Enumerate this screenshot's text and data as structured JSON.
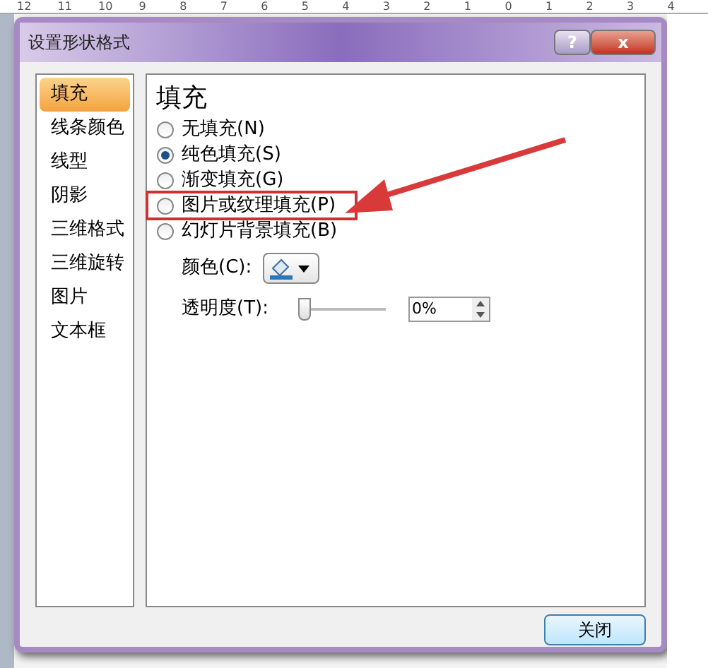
{
  "ruler": {
    "ticks": [
      "12",
      "11",
      "10",
      "9",
      "8",
      "7",
      "6",
      "5",
      "4",
      "3",
      "2",
      "1",
      "0",
      "1",
      "2",
      "3",
      "4"
    ]
  },
  "dialog": {
    "title": "设置形状格式",
    "help": "?",
    "close": "x"
  },
  "sidebar": {
    "items": [
      {
        "label": "填充",
        "selected": true
      },
      {
        "label": "线条颜色",
        "selected": false
      },
      {
        "label": "线型",
        "selected": false
      },
      {
        "label": "阴影",
        "selected": false
      },
      {
        "label": "三维格式",
        "selected": false
      },
      {
        "label": "三维旋转",
        "selected": false
      },
      {
        "label": "图片",
        "selected": false
      },
      {
        "label": "文本框",
        "selected": false
      }
    ]
  },
  "panel": {
    "heading": "填充",
    "options": [
      {
        "label": "无填充(N)",
        "selected": false,
        "highlighted": false
      },
      {
        "label": "纯色填充(S)",
        "selected": true,
        "highlighted": false
      },
      {
        "label": "渐变填充(G)",
        "selected": false,
        "highlighted": false
      },
      {
        "label": "图片或纹理填充(P)",
        "selected": false,
        "highlighted": true
      },
      {
        "label": "幻灯片背景填充(B)",
        "selected": false,
        "highlighted": false
      }
    ],
    "color": {
      "label": "颜色(C):"
    },
    "transparency": {
      "label": "透明度(T):",
      "level": 0,
      "value": "0%"
    }
  },
  "buttons": [
    {
      "label": "关闭"
    }
  ]
}
